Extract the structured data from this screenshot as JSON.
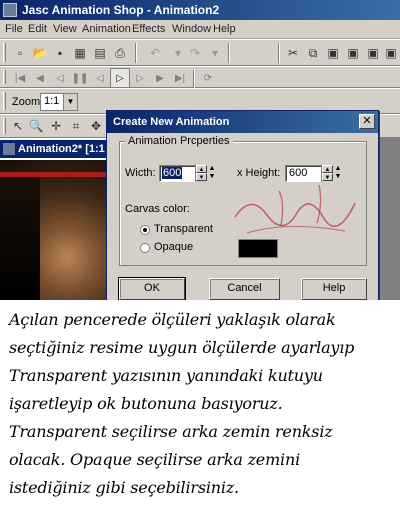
{
  "window": {
    "title": "Jasc Animation Shop - Animation2"
  },
  "menu": [
    "File",
    "Edit",
    "View",
    "Animation",
    "Effects",
    "Window",
    "Help"
  ],
  "toolbar_main": {
    "icons": [
      "new-icon",
      "open-icon",
      "save-icon",
      "film-icon",
      "frames-icon",
      "print-icon",
      "undo-icon",
      "redo-icon",
      "cut-icon",
      "copy-icon",
      "paste-icon",
      "paste-as-frames-icon",
      "paste-into-icon"
    ]
  },
  "toolbar_playback": {
    "icons": [
      "first-frame-icon",
      "prev-frame-icon",
      "step-back-icon",
      "pause-icon",
      "play-back-icon",
      "play-icon",
      "step-forward-icon",
      "next-frame-icon",
      "last-frame-icon",
      "loop-icon"
    ]
  },
  "zoom": {
    "label": "Zoom:",
    "value": "1:1"
  },
  "document": {
    "title": "Animation2* [1:1"
  },
  "dialog": {
    "title": "Create New Animation",
    "close_glyph": "✕",
    "group_label": "Animation Prcperties",
    "width_label": "Wicth:",
    "width_value": "600",
    "height_label": "x  Height:",
    "height_value": "600",
    "canvas_color_label": "Carvas color:",
    "options": [
      {
        "label": "Transparent",
        "selected": true
      },
      {
        "label": "Opaque",
        "selected": false
      }
    ],
    "swatch_color": "#000000",
    "ok_label": "OK",
    "cancel_label": "Cancel",
    "help_label": "Help"
  },
  "watermark": {
    "signature": "1dmt hzu"
  },
  "caption": {
    "lines": [
      "Açılan pencerede ölçüleri yaklaşık olarak",
      "seçtiğiniz resime uygun ölçülerde ayarlayıp",
      "Transparent yazısının yanındaki kutuyu",
      "işaretleyip ok butonuna basıyoruz.",
      "Transparent seçilirse arka zemin renksiz",
      "olacak. Opaque seçilirse arka zemini",
      "istediğiniz gibi seçebilirsiniz."
    ]
  },
  "colors": {
    "titlebar": "#0a246a",
    "chrome": "#d4d0c8",
    "selection": "#0a246a",
    "doc_accent": "#a81c1c"
  }
}
